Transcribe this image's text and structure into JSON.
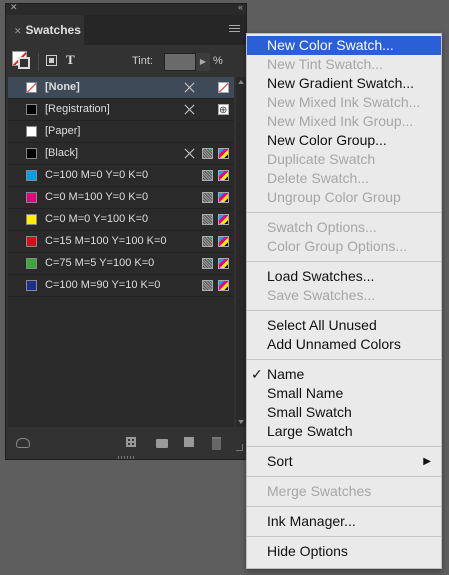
{
  "panel": {
    "tab_title": "Swatches",
    "tint_label": "Tint:",
    "tint_value": "",
    "tint_unit": "%",
    "swatches": [
      {
        "name": "[None]",
        "color": "#ffffff",
        "selected": true,
        "mode": "none",
        "editable": false,
        "spot": false
      },
      {
        "name": "[Registration]",
        "color": "#000000",
        "selected": false,
        "mode": "reg",
        "editable": false,
        "spot": false
      },
      {
        "name": "[Paper]",
        "color": "#ffffff",
        "selected": false,
        "mode": "",
        "editable": true,
        "spot": false
      },
      {
        "name": "[Black]",
        "color": "#000000",
        "selected": false,
        "mode": "cmyk",
        "editable": false,
        "spot": true
      },
      {
        "name": "C=100 M=0 Y=0 K=0",
        "color": "#00a0e9",
        "selected": false,
        "mode": "cmyk",
        "editable": true,
        "spot": true
      },
      {
        "name": "C=0 M=100 Y=0 K=0",
        "color": "#e4007f",
        "selected": false,
        "mode": "cmyk",
        "editable": true,
        "spot": true
      },
      {
        "name": "C=0 M=0 Y=100 K=0",
        "color": "#fff100",
        "selected": false,
        "mode": "cmyk",
        "editable": true,
        "spot": true
      },
      {
        "name": "C=15 M=100 Y=100 K=0",
        "color": "#d0121b",
        "selected": false,
        "mode": "cmyk",
        "editable": true,
        "spot": true
      },
      {
        "name": "C=75 M=5 Y=100 K=0",
        "color": "#3aa935",
        "selected": false,
        "mode": "cmyk",
        "editable": true,
        "spot": true
      },
      {
        "name": "C=100 M=90 Y=10 K=0",
        "color": "#1d2f8a",
        "selected": false,
        "mode": "cmyk",
        "editable": true,
        "spot": true
      }
    ]
  },
  "menu": {
    "items": [
      {
        "label": "New Color Swatch...",
        "enabled": true,
        "highlighted": true,
        "group": 1
      },
      {
        "label": "New Tint Swatch...",
        "enabled": false,
        "group": 1
      },
      {
        "label": "New Gradient Swatch...",
        "enabled": true,
        "group": 1
      },
      {
        "label": "New Mixed Ink Swatch...",
        "enabled": false,
        "group": 1
      },
      {
        "label": "New Mixed Ink Group...",
        "enabled": false,
        "group": 1
      },
      {
        "label": "New Color Group...",
        "enabled": true,
        "group": 1
      },
      {
        "label": "Duplicate Swatch",
        "enabled": false,
        "group": 1
      },
      {
        "label": "Delete Swatch...",
        "enabled": false,
        "group": 1
      },
      {
        "label": "Ungroup Color Group",
        "enabled": false,
        "group": 1
      },
      {
        "label": "Swatch Options...",
        "enabled": false,
        "group": 2
      },
      {
        "label": "Color Group Options...",
        "enabled": false,
        "group": 2
      },
      {
        "label": "Load Swatches...",
        "enabled": true,
        "group": 3
      },
      {
        "label": "Save Swatches...",
        "enabled": false,
        "group": 3
      },
      {
        "label": "Select All Unused",
        "enabled": true,
        "group": 4
      },
      {
        "label": "Add Unnamed Colors",
        "enabled": true,
        "group": 4
      },
      {
        "label": "Name",
        "enabled": true,
        "checked": true,
        "group": 5
      },
      {
        "label": "Small Name",
        "enabled": true,
        "group": 5
      },
      {
        "label": "Small Swatch",
        "enabled": true,
        "group": 5
      },
      {
        "label": "Large Swatch",
        "enabled": true,
        "group": 5
      },
      {
        "label": "Sort",
        "enabled": true,
        "submenu": true,
        "group": 6
      },
      {
        "label": "Merge Swatches",
        "enabled": false,
        "group": 7
      },
      {
        "label": "Ink Manager...",
        "enabled": true,
        "group": 8
      },
      {
        "label": "Hide Options",
        "enabled": true,
        "group": 9
      }
    ]
  },
  "colors": {
    "highlight": "#2a5fd8",
    "panel_bg": "#323232",
    "menu_bg": "#eaeaea",
    "disabled_text": "#a6a6a6"
  },
  "icons": {
    "close": "close-icon",
    "collapse": "double-chevron-icon",
    "panel_menu": "hamburger-icon",
    "submenu": "triangle-right-icon",
    "check": "checkmark-icon"
  }
}
